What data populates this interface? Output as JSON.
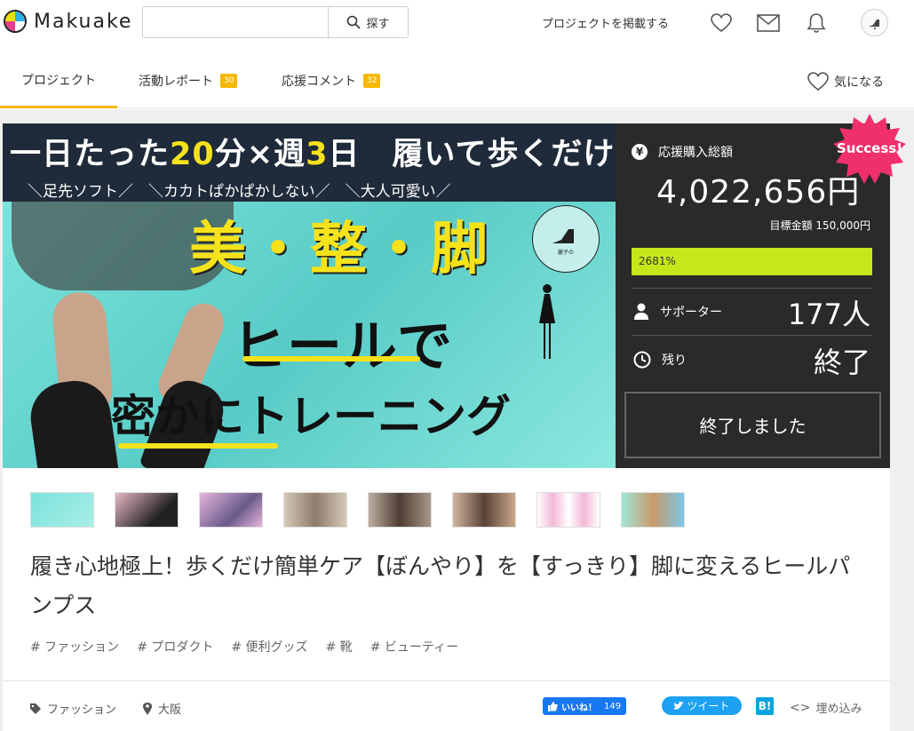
{
  "header": {
    "logo_text": "Makuake",
    "search_placeholder": "",
    "search_button": "探す",
    "post_project": "プロジェクトを掲載する",
    "avatar_label": "麗子のパンプス"
  },
  "tabs": [
    {
      "label": "プロジェクト",
      "badge": ""
    },
    {
      "label": "活動レポート",
      "badge": "30"
    },
    {
      "label": "応援コメント",
      "badge": "32"
    }
  ],
  "favorite_label": "気になる",
  "hero": {
    "line1_a": "一日たった",
    "line1_b": "20",
    "line1_c": "分×週",
    "line1_d": "3",
    "line1_e": "日　履いて歩くだけ",
    "line2": "＼足先ソフト／　＼カカトぱかぱかしない／　＼大人可愛い／",
    "big": "美・整・脚",
    "mid": "ヒールで",
    "bottom": "密かにトレーニング",
    "stamp_text": "麗子の\nパンプスフィット\nストラップ"
  },
  "stats": {
    "total_label": "応援購入総額",
    "total_value": "4,022,656円",
    "goal_label": "目標金額 150,000円",
    "progress_text": "2681%",
    "progress_fraction": 1.0,
    "supporters_label": "サポーター",
    "supporters_value": "177人",
    "remaining_label": "残り",
    "remaining_value": "終了",
    "ended_button": "終了しました",
    "success_badge": "Success!"
  },
  "title": "履き心地極上！歩くだけ簡単ケア【ぼんやり】を【すっきり】脚に変えるヒールパンプス",
  "tags": [
    "# ファッション",
    "# プロダクト",
    "# 便利グッズ",
    "# 靴",
    "# ビューティー"
  ],
  "meta": {
    "category": "ファッション",
    "location": "大阪"
  },
  "share": {
    "like_label": "いいね！",
    "like_count": "149",
    "tweet_label": "ツイート",
    "hatena_label": "B!",
    "embed_label": "埋め込み"
  },
  "colors": {
    "accent": "#f5b800",
    "progress": "#c4e81a",
    "success": "#f0306c",
    "panel": "#2a2a2a"
  }
}
